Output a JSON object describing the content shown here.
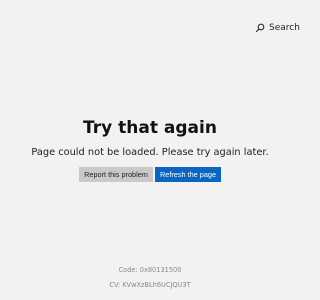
{
  "header": {
    "search_label": "Search",
    "search_icon": "search-icon"
  },
  "error": {
    "title": "Try that again",
    "message": "Page could not be loaded. Please try again later."
  },
  "actions": {
    "report_label": "Report this problem",
    "refresh_label": "Refresh the page"
  },
  "footer": {
    "code": "Code: 0x80131500",
    "cv": "CV: KVwXzBLh6UCJQU3T"
  },
  "colors": {
    "primary": "#0a66c2",
    "secondary": "#c9c9c9",
    "background": "#f2f2f2"
  }
}
